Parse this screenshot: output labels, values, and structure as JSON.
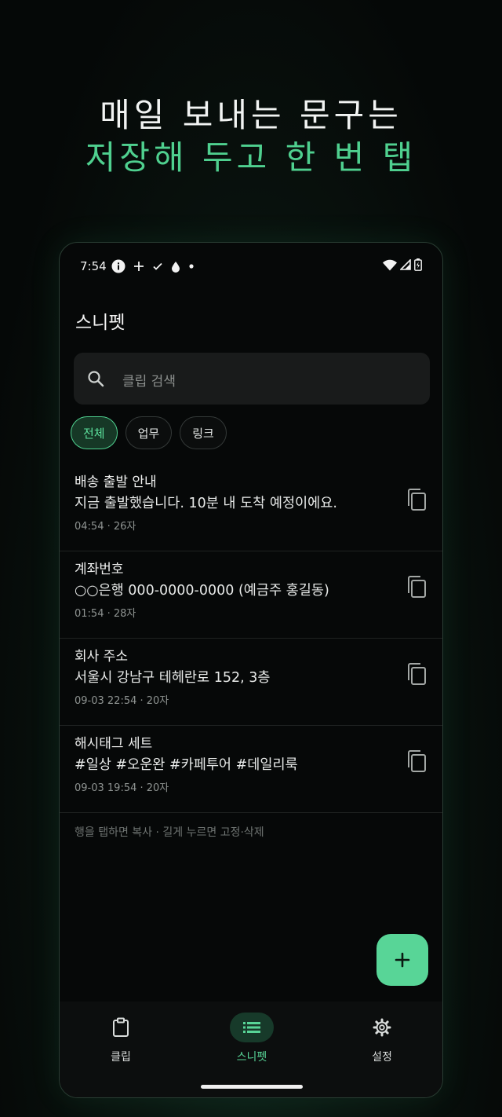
{
  "headline": {
    "line1": "매일 보내는 문구는",
    "line2": "저장해 두고 한 번 탭"
  },
  "status_bar": {
    "time": "7:54"
  },
  "app": {
    "title": "스니펫"
  },
  "search": {
    "placeholder": "클립 검색"
  },
  "filters": [
    {
      "label": "전체",
      "active": true
    },
    {
      "label": "업무",
      "active": false
    },
    {
      "label": "링크",
      "active": false
    }
  ],
  "snippets": [
    {
      "title": "배송 출발 안내",
      "body": "지금 출발했습니다. 10분 내 도착 예정이에요.",
      "meta": "04:54 · 26자"
    },
    {
      "title": "계좌번호",
      "body": "○○은행 000-0000-0000 (예금주 홍길동)",
      "meta": "01:54 · 28자"
    },
    {
      "title": "회사 주소",
      "body": "서울시 강남구 테헤란로 152, 3층",
      "meta": "09-03 22:54 · 20자"
    },
    {
      "title": "해시태그 세트",
      "body": "#일상 #오운완 #카페투어 #데일리룩",
      "meta": "09-03 19:54 · 20자"
    }
  ],
  "hint": "행을 탭하면 복사 · 길게 누르면 고정·삭제",
  "fab": {
    "icon": "plus-icon"
  },
  "nav": [
    {
      "label": "클립",
      "icon": "clipboard-icon",
      "active": false
    },
    {
      "label": "스니펫",
      "icon": "list-icon",
      "active": true
    },
    {
      "label": "설정",
      "icon": "gear-icon",
      "active": false
    }
  ],
  "colors": {
    "accent": "#58d597",
    "background": "#060808",
    "surface": "#191b1b"
  }
}
